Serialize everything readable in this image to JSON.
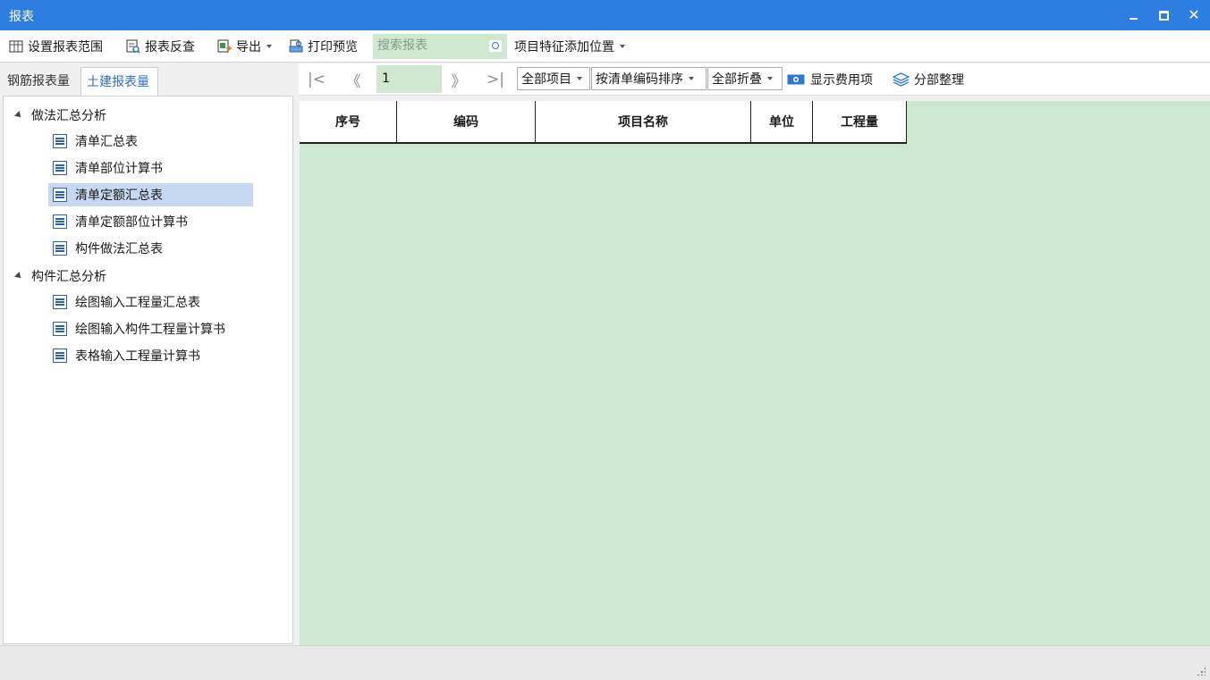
{
  "window": {
    "title": "报表"
  },
  "toolbar": {
    "set_range": "设置报表范围",
    "reverse_check": "报表反查",
    "export": "导出",
    "print_preview": "打印预览",
    "search_placeholder": "搜索报表",
    "feature_position": "项目特征添加位置"
  },
  "tabs": {
    "rebar": "钢筋报表量",
    "civil": "土建报表量"
  },
  "tree": {
    "group1": "做法汇总分析",
    "group1_items": [
      "清单汇总表",
      "清单部位计算书",
      "清单定额汇总表",
      "清单定额部位计算书",
      "构件做法汇总表"
    ],
    "group2": "构件汇总分析",
    "group2_items": [
      "绘图输入工程量汇总表",
      "绘图输入构件工程量计算书",
      "表格输入工程量计算书"
    ],
    "selected": "清单定额汇总表"
  },
  "nav": {
    "page": "1",
    "all_items": "全部项目",
    "sort": "按清单编码排序",
    "collapse": "全部折叠",
    "show_cost": "显示费用项",
    "section_sort": "分部整理"
  },
  "grid": {
    "headers": [
      "序号",
      "编码",
      "项目名称",
      "单位",
      "工程量"
    ]
  }
}
